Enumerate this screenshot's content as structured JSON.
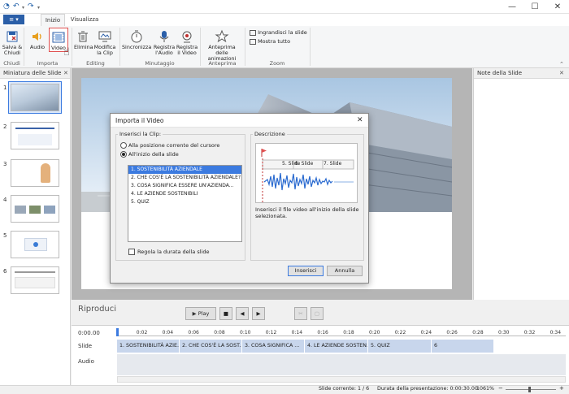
{
  "window": {
    "minimize": "—",
    "maximize": "☐",
    "close": "✕"
  },
  "tabs": {
    "file_icon": "≡",
    "home": "Inizio",
    "view": "Visualizza"
  },
  "ribbon": {
    "save_close": "Salva &\nChiudi",
    "audio": "Audio",
    "video": "Video",
    "delete": "Elimina",
    "edit_clip": "Modifica\nla Clip",
    "sync": "Sincronizza",
    "record_audio": "Registra\nl'Audio",
    "record_video": "Registra\nil Video",
    "preview_anim": "Anteprima delle\nanimazioni",
    "enlarge": "Ingrandisci la slide",
    "show_all": "Mostra tutto",
    "groups": {
      "close": "Chiudi",
      "import": "Importa",
      "editing": "Editing",
      "timing": "Minutaggio",
      "preview": "Anteprima",
      "zoom": "Zoom"
    }
  },
  "left_panel": {
    "title": "Miniatura delle Slide",
    "numbers": [
      "1",
      "2",
      "3",
      "4",
      "5",
      "6"
    ]
  },
  "right_panel": {
    "title": "Note della Slide"
  },
  "dialog": {
    "title": "Importa il Video",
    "insert_group": "Inserisci la Clip:",
    "radio1": "Alla posizione corrente del cursore",
    "radio2": "All'inizio della slide",
    "items": [
      "1. SOSTENIBILITÀ AZIENDALE",
      "2. CHE COS'È LA SOSTENIBILITÀ AZIENDALE?",
      "3. COSA SIGNIFICA ESSERE UN'AZIENDA...",
      "4. LE AZIENDE SOSTENIBILI",
      "5. QUIZ"
    ],
    "checkbox": "Regola la durata della slide",
    "desc_group": "Descrizione",
    "preview_slides": [
      "5. Slide",
      "6. Slide",
      "7. Slide"
    ],
    "desc_text": "Inserisci il file video all'inizio della slide selezionata.",
    "ok": "Inserisci",
    "cancel": "Annulla"
  },
  "playback": {
    "title": "Riproduci",
    "play": "Play"
  },
  "timeline": {
    "time": "0:00.00",
    "ticks": [
      "0:02",
      "0:04",
      "0:06",
      "0:08",
      "0:10",
      "0:12",
      "0:14",
      "0:16",
      "0:18",
      "0:20",
      "0:22",
      "0:24",
      "0:26",
      "0:28",
      "0:30",
      "0:32",
      "0:34"
    ],
    "slide_label": "Slide",
    "audio_label": "Audio",
    "segments": [
      "1. SOSTENIBILITÀ AZIE...",
      "2. CHE COS'È LA SOST...",
      "3. COSA SIGNIFICA ...",
      "4. LE AZIENDE SOSTEN...",
      "5. QUIZ",
      "6"
    ]
  },
  "status": {
    "current": "Slide corrente: 1 / 6",
    "duration": "Durata della presentazione: 0:00:30.00",
    "zoom": "1061%"
  },
  "colors": {
    "accent": "#2b5fa8",
    "selection": "#3c7be0",
    "segment": "#c8d6ec",
    "highlight": "#e05050"
  }
}
